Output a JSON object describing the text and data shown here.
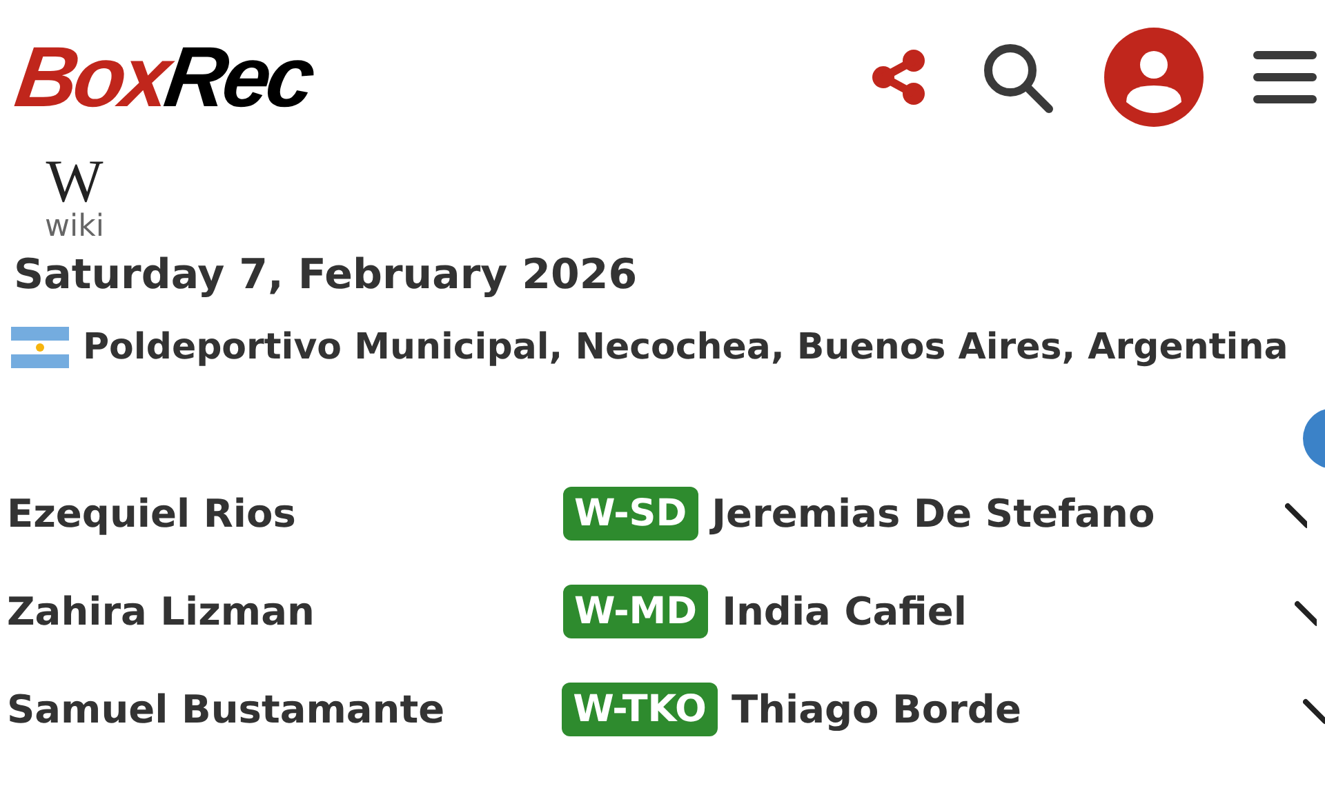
{
  "logo": {
    "parts": [
      {
        "text": "Box",
        "color": "#c0261c"
      },
      {
        "text": "Rec",
        "color": "#000000"
      }
    ]
  },
  "wiki": {
    "glyph": "W",
    "label": "wiki"
  },
  "event": {
    "date": "Saturday 7, February 2026",
    "venue": "Poldeportivo Municipal, Necochea, Buenos Aires, Argentina"
  },
  "bouts": [
    {
      "fighter_a": "Ezequiel Rios",
      "result": "W-SD",
      "fighter_b": "Jeremias De Stefano"
    },
    {
      "fighter_a": "Zahira Lizman",
      "result": "W-MD",
      "fighter_b": "India Cafiel"
    },
    {
      "fighter_a": "Samuel Bustamante",
      "result": "W-TKO",
      "fighter_b": "Thiago Borde"
    }
  ]
}
